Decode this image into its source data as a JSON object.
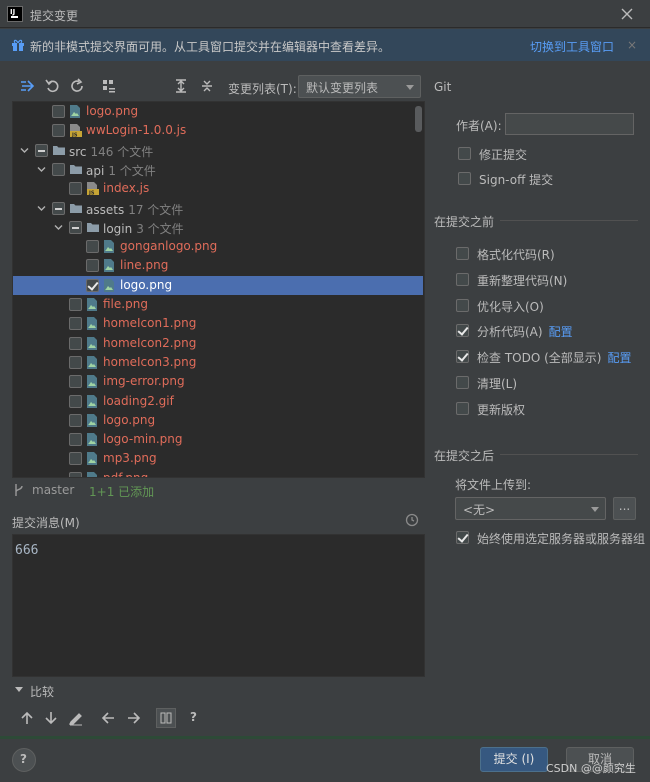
{
  "window": {
    "title": "提交变更",
    "close_icon": "close-icon"
  },
  "banner": {
    "text": "新的非模式提交界面可用。从工具窗口提交并在编辑器中查看差异。",
    "link": "切换到工具窗口",
    "close": "×"
  },
  "toolbar": {
    "changelist_label": "变更列表(T):",
    "changelist_value": "默认变更列表"
  },
  "tree": [
    {
      "name": "logo.png",
      "color": "red",
      "icon": "image-file-icon",
      "check": "none",
      "indent": 1,
      "chevron": ""
    },
    {
      "name": "wwLogin-1.0.0.js",
      "color": "red",
      "icon": "js-file-icon",
      "check": "none",
      "indent": 1,
      "chevron": ""
    },
    {
      "name": "src",
      "count": "146 个文件",
      "color": "dir",
      "icon": "folder-icon",
      "check": "partial",
      "indent": 0,
      "chevron": "down"
    },
    {
      "name": "api",
      "count": "1 个文件",
      "color": "dir",
      "icon": "folder-icon",
      "check": "none",
      "indent": 1,
      "chevron": "down"
    },
    {
      "name": "index.js",
      "color": "red",
      "icon": "js-file-icon",
      "check": "none",
      "indent": 2,
      "chevron": ""
    },
    {
      "name": "assets",
      "count": "17 个文件",
      "color": "dir",
      "icon": "folder-icon",
      "check": "partial",
      "indent": 1,
      "chevron": "down"
    },
    {
      "name": "login",
      "count": "3 个文件",
      "color": "dir",
      "icon": "folder-icon",
      "check": "partial",
      "indent": 2,
      "chevron": "down"
    },
    {
      "name": "gonganlogo.png",
      "color": "red",
      "icon": "image-file-icon",
      "check": "none",
      "indent": 3,
      "chevron": ""
    },
    {
      "name": "line.png",
      "color": "red",
      "icon": "image-file-icon",
      "check": "none",
      "indent": 3,
      "chevron": ""
    },
    {
      "name": "logo.png",
      "color": "sel",
      "icon": "image-file-icon",
      "check": "checked",
      "indent": 3,
      "chevron": "",
      "selected": true
    },
    {
      "name": "file.png",
      "color": "red",
      "icon": "image-file-icon",
      "check": "none",
      "indent": 2,
      "chevron": ""
    },
    {
      "name": "homeIcon1.png",
      "color": "red",
      "icon": "image-file-icon",
      "check": "none",
      "indent": 2,
      "chevron": ""
    },
    {
      "name": "homeIcon2.png",
      "color": "red",
      "icon": "image-file-icon",
      "check": "none",
      "indent": 2,
      "chevron": ""
    },
    {
      "name": "homeIcon3.png",
      "color": "red",
      "icon": "image-file-icon",
      "check": "none",
      "indent": 2,
      "chevron": ""
    },
    {
      "name": "img-error.png",
      "color": "red",
      "icon": "image-file-icon",
      "check": "none",
      "indent": 2,
      "chevron": ""
    },
    {
      "name": "loading2.gif",
      "color": "red",
      "icon": "image-file-icon",
      "check": "none",
      "indent": 2,
      "chevron": ""
    },
    {
      "name": "logo.png",
      "color": "red",
      "icon": "image-file-icon",
      "check": "none",
      "indent": 2,
      "chevron": ""
    },
    {
      "name": "logo-min.png",
      "color": "red",
      "icon": "image-file-icon",
      "check": "none",
      "indent": 2,
      "chevron": ""
    },
    {
      "name": "mp3.png",
      "color": "red",
      "icon": "image-file-icon",
      "check": "none",
      "indent": 2,
      "chevron": ""
    },
    {
      "name": "pdf.png",
      "color": "red",
      "icon": "image-file-icon",
      "check": "none",
      "indent": 2,
      "chevron": ""
    }
  ],
  "status": {
    "branch": "master",
    "added": "1+1 已添加"
  },
  "commit": {
    "label": "提交消息(M)",
    "message": "666"
  },
  "compare": {
    "label": "比较"
  },
  "buttons": {
    "help": "?",
    "commit": "提交 (I)",
    "cancel": "取消"
  },
  "watermark": "CSDN @@颜究生",
  "right": {
    "git_title": "Git",
    "author_label": "作者(A):",
    "author_value": "",
    "git_options": [
      {
        "label": "修正提交",
        "checked": false
      },
      {
        "label": "Sign-off 提交",
        "checked": false
      }
    ],
    "before_title": "在提交之前",
    "before_options": [
      {
        "label": "格式化代码(R)",
        "checked": false,
        "link": ""
      },
      {
        "label": "重新整理代码(N)",
        "checked": false,
        "link": ""
      },
      {
        "label": "优化导入(O)",
        "checked": false,
        "link": ""
      },
      {
        "label": "分析代码(A)",
        "checked": true,
        "link": "配置"
      },
      {
        "label": "检查 TODO (全部显示)",
        "checked": true,
        "link": "配置"
      },
      {
        "label": "清理(L)",
        "checked": false,
        "link": ""
      },
      {
        "label": "更新版权",
        "checked": false,
        "link": ""
      }
    ],
    "after_title": "在提交之后",
    "upload_label": "将文件上传到:",
    "upload_value": "<无>",
    "upload_more": "...",
    "after_options": [
      {
        "label": "始终使用选定服务器或服务器组",
        "checked": true
      }
    ]
  },
  "colors": {
    "accent": "#589df6",
    "selection": "#4b6eaf",
    "unversioned": "#e06c5a",
    "added": "#629755"
  }
}
